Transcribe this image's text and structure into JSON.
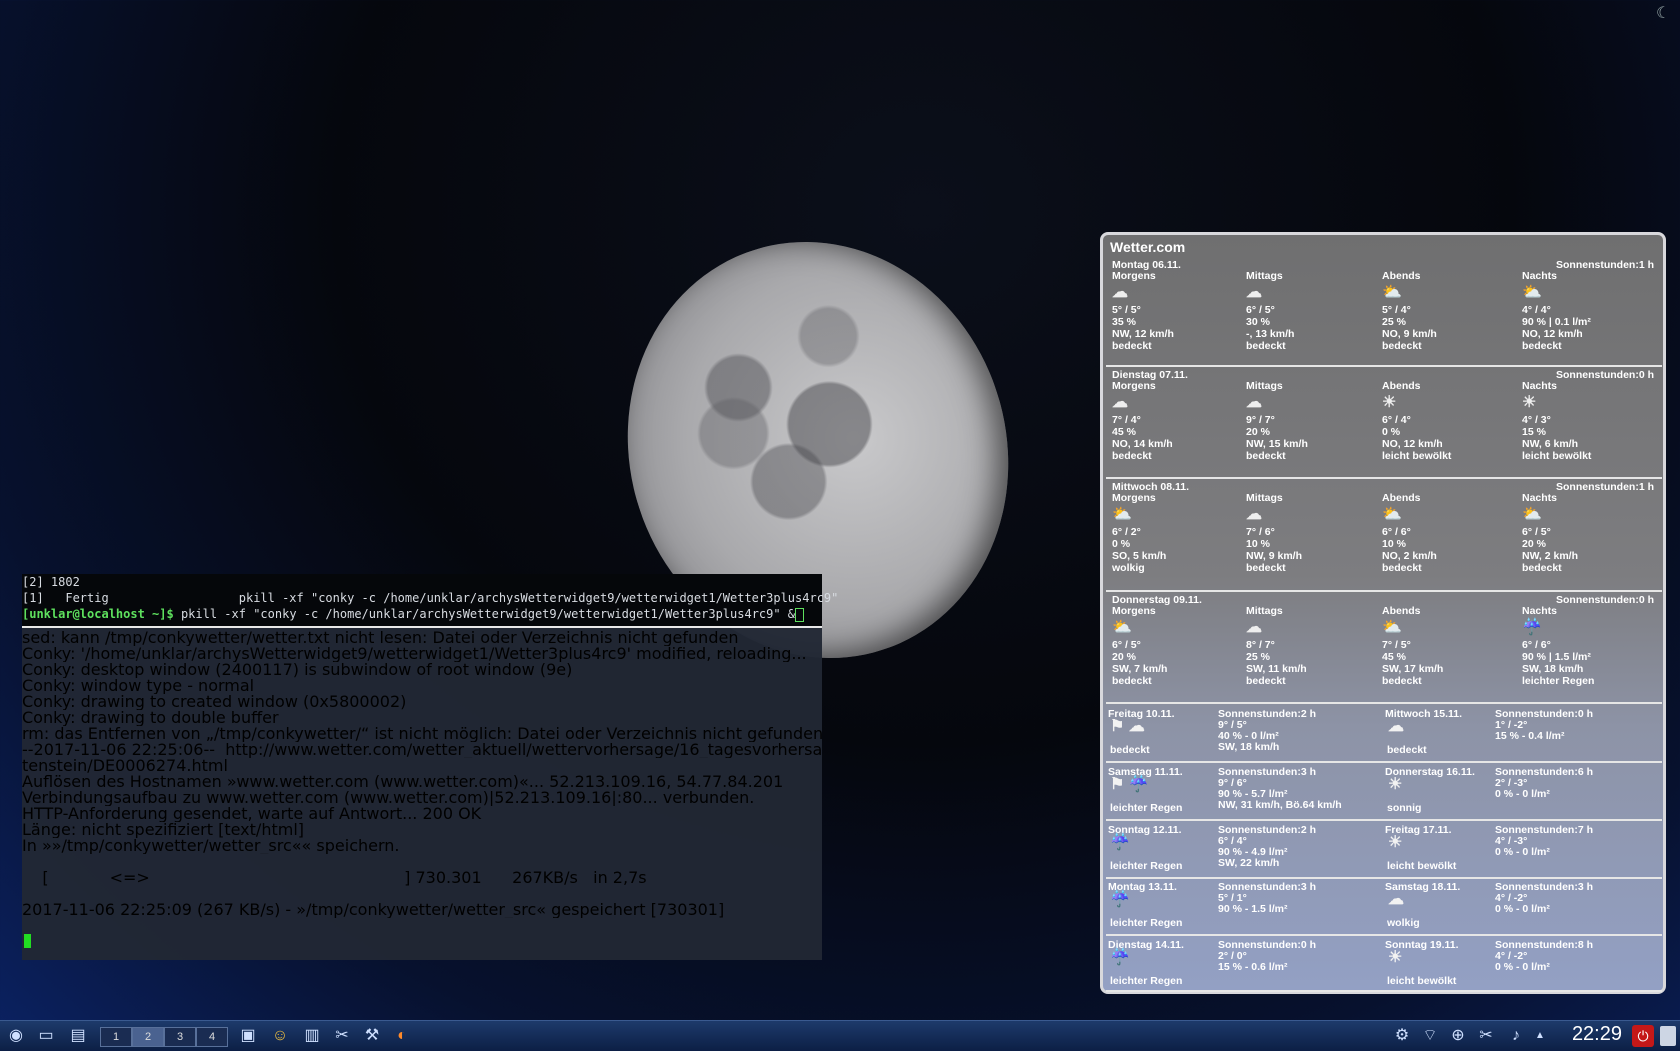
{
  "terminal": {
    "top_lines": [
      "[2] 1802",
      "[1]   Fertig                  pkill -xf \"conky -c /home/unklar/archysWetterwidget9/wetterwidget1/Wetter3plus4rc9\""
    ],
    "prompt": "[unklar@localhost ~]$",
    "command": " pkill -xf \"conky -c /home/unklar/archysWetterwidget9/wetterwidget1/Wetter3plus4rc9\" &",
    "body_lines": [
      "sed: kann /tmp/conkywetter/wetter.txt nicht lesen: Datei oder Verzeichnis nicht gefunden",
      "Conky: '/home/unklar/archysWetterwidget9/wetterwidget1/Wetter3plus4rc9' modified, reloading...",
      "Conky: desktop window (2400117) is subwindow of root window (9e)",
      "Conky: window type - normal",
      "Conky: drawing to created window (0x5800002)",
      "Conky: drawing to double buffer",
      "rm: das Entfernen von „/tmp/conkywetter/“ ist nicht möglich: Datei oder Verzeichnis nicht gefunden",
      "--2017-11-06 22:25:06--  http://www.wetter.com/wetter_aktuell/wettervorhersage/16_tagesvorhersage/deutschland/lich",
      "tenstein/DE0006274.html",
      "Auflösen des Hostnamen »www.wetter.com (www.wetter.com)«... 52.213.109.16, 54.77.84.201",
      "Verbindungsaufbau zu www.wetter.com (www.wetter.com)|52.213.109.16|:80... verbunden.",
      "HTTP-Anforderung gesendet, warte auf Antwort... 200 OK",
      "Länge: nicht spezifiziert [text/html]",
      "In »»/tmp/conkywetter/wetter_src«« speichern.",
      "",
      "    [            <=>                                                  ] 730.301      267KB/s   in 2,7s",
      "",
      "2017-11-06 22:25:09 (267 KB/s) - »/tmp/conkywetter/wetter_src« gespeichert [730301]"
    ]
  },
  "widget": {
    "title": "Wetter.com",
    "days": [
      {
        "name": "Montag 06.11.",
        "sun": "Sonnenstunden:1 h",
        "cols": [
          {
            "label": "Morgens",
            "icon": "cloud-icon",
            "temp": "5° / 5°",
            "rain": "35 %",
            "wind": "NW, 12 km/h",
            "desc": "bedeckt"
          },
          {
            "label": "Mittags",
            "icon": "cloud-icon",
            "temp": "6° / 5°",
            "rain": "30 %",
            "wind": "-, 13 km/h",
            "desc": "bedeckt"
          },
          {
            "label": "Abends",
            "icon": "cloud-sun-icon",
            "temp": "5° / 4°",
            "rain": "25 %",
            "wind": "NO, 9 km/h",
            "desc": "bedeckt"
          },
          {
            "label": "Nachts",
            "icon": "cloud-sun-icon",
            "temp": "4° / 4°",
            "rain": "90 % | 0.1 l/m²",
            "wind": "NO, 12 km/h",
            "desc": "bedeckt"
          }
        ]
      },
      {
        "name": "Dienstag 07.11.",
        "sun": "Sonnenstunden:0 h",
        "cols": [
          {
            "label": "Morgens",
            "icon": "cloud-icon",
            "temp": "7° / 4°",
            "rain": "45 %",
            "wind": "NO, 14 km/h",
            "desc": "bedeckt"
          },
          {
            "label": "Mittags",
            "icon": "cloud-icon",
            "temp": "9° / 7°",
            "rain": "20 %",
            "wind": "NW, 15 km/h",
            "desc": "bedeckt"
          },
          {
            "label": "Abends",
            "icon": "sun-icon",
            "temp": "6° / 4°",
            "rain": "0 %",
            "wind": "NO, 12 km/h",
            "desc": "leicht bewölkt"
          },
          {
            "label": "Nachts",
            "icon": "sun-icon",
            "temp": "4° / 3°",
            "rain": "15 %",
            "wind": "NW, 6 km/h",
            "desc": "leicht bewölkt"
          }
        ]
      },
      {
        "name": "Mittwoch 08.11.",
        "sun": "Sonnenstunden:1 h",
        "cols": [
          {
            "label": "Morgens",
            "icon": "cloud-sun-icon",
            "temp": "6° / 2°",
            "rain": "0 %",
            "wind": "SO, 5 km/h",
            "desc": "wolkig"
          },
          {
            "label": "Mittags",
            "icon": "cloud-icon",
            "temp": "7° / 6°",
            "rain": "10 %",
            "wind": "NW, 9 km/h",
            "desc": "bedeckt"
          },
          {
            "label": "Abends",
            "icon": "cloud-sun-icon",
            "temp": "6° / 6°",
            "rain": "10 %",
            "wind": "NO, 2 km/h",
            "desc": "bedeckt"
          },
          {
            "label": "Nachts",
            "icon": "cloud-sun-icon",
            "temp": "6° / 5°",
            "rain": "20 %",
            "wind": "NW, 2 km/h",
            "desc": "bedeckt"
          }
        ]
      },
      {
        "name": "Donnerstag 09.11.",
        "sun": "Sonnenstunden:0 h",
        "cols": [
          {
            "label": "Morgens",
            "icon": "cloud-sun-icon",
            "temp": "6° / 5°",
            "rain": "20 %",
            "wind": "SW, 7 km/h",
            "desc": "bedeckt"
          },
          {
            "label": "Mittags",
            "icon": "cloud-icon",
            "temp": "8° / 7°",
            "rain": "25 %",
            "wind": "SW, 11 km/h",
            "desc": "bedeckt"
          },
          {
            "label": "Abends",
            "icon": "cloud-sun-icon",
            "temp": "7° / 5°",
            "rain": "45 %",
            "wind": "SW, 17 km/h",
            "desc": "bedeckt"
          },
          {
            "label": "Nachts",
            "icon": "rain-cloud-icon",
            "temp": "6° / 6°",
            "rain": "90 % | 1.5 l/m²",
            "wind": "SW, 18 km/h",
            "desc": "leichter Regen"
          }
        ]
      }
    ],
    "short": [
      {
        "left": {
          "name": "Freitag 10.11.",
          "desc": "bedeckt",
          "sun": "Sonnenstunden:2 h",
          "lines": [
            "9° / 5°",
            "40 % - 0 l/m²",
            "SW, 18 km/h"
          ]
        },
        "right": {
          "name": "Mittwoch 15.11.",
          "desc": "bedeckt",
          "sun": "Sonnenstunden:0 h",
          "lines": [
            "1° / -2°",
            "15 % - 0.4 l/m²"
          ]
        }
      },
      {
        "left": {
          "name": "Samstag 11.11.",
          "desc": "leichter Regen",
          "sun": "Sonnenstunden:3 h",
          "lines": [
            "9° / 6°",
            "90 % - 5.7 l/m²",
            "NW, 31 km/h, Bö.64 km/h"
          ]
        },
        "right": {
          "name": "Donnerstag 16.11.",
          "desc": "sonnig",
          "sun": "Sonnenstunden:6 h",
          "lines": [
            "2° / -3°",
            "0 % - 0 l/m²"
          ]
        }
      },
      {
        "left": {
          "name": "Sonntag 12.11.",
          "desc": "leichter Regen",
          "sun": "Sonnenstunden:2 h",
          "lines": [
            "6° / 4°",
            "90 % - 4.9 l/m²",
            "SW, 22 km/h"
          ]
        },
        "right": {
          "name": "Freitag 17.11.",
          "desc": "leicht bewölkt",
          "sun": "Sonnenstunden:7 h",
          "lines": [
            "4° / -3°",
            "0 % - 0 l/m²"
          ]
        }
      },
      {
        "left": {
          "name": "Montag 13.11.",
          "desc": "leichter Regen",
          "sun": "Sonnenstunden:3 h",
          "lines": [
            "5° / 1°",
            "90 % - 1.5 l/m²"
          ]
        },
        "right": {
          "name": "Samstag 18.11.",
          "desc": "wolkig",
          "sun": "Sonnenstunden:3 h",
          "lines": [
            "4° / -2°",
            "0 % - 0 l/m²"
          ]
        }
      },
      {
        "left": {
          "name": "Dienstag 14.11.",
          "desc": "leichter Regen",
          "sun": "Sonnenstunden:0 h",
          "lines": [
            "2° / 0°",
            "15 % - 0.6 l/m²"
          ]
        },
        "right": {
          "name": "Sonntag 19.11.",
          "desc": "leicht bewölkt",
          "sun": "Sonnenstunden:8 h",
          "lines": [
            "4° / -2°",
            "0 % - 0 l/m²"
          ]
        }
      }
    ]
  },
  "taskbar": {
    "desktops": [
      "1",
      "2",
      "3",
      "4"
    ],
    "active_desktop": "2",
    "clock": "22:29"
  }
}
